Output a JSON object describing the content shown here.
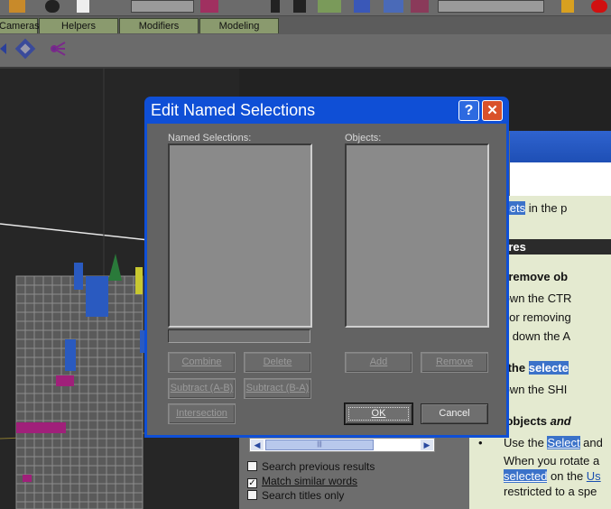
{
  "toolbar": {
    "tabs": [
      "Cameras",
      "Helpers",
      "Modifiers",
      "Modeling"
    ]
  },
  "dialog": {
    "title": "Edit Named Selections",
    "help_label": "?",
    "close_label": "✕",
    "named_selections_label": "Named Selections:",
    "objects_label": "Objects:",
    "buttons": {
      "combine": "Combine",
      "delete": "Delete",
      "subtract_ab": "Subtract (A-B)",
      "subtract_ba": "Subtract (B-A)",
      "intersection": "Intersection",
      "add": "Add",
      "remove": "Remove",
      "ok": "OK",
      "cancel": "Cancel"
    }
  },
  "help": {
    "line1_hl": "ection sets",
    "line1_rest": " in the p",
    "procedures": "rocedures",
    "add_remove": "add or remove ob",
    "hold_ctr": "Hold down the CTR",
    "adding": "Adding or removing",
    "holding_a": "Holding down the A",
    "toggle_pre": "toggle the ",
    "toggle_hl": "selecte",
    "hold_shi": "Hold down the SHI",
    "select_hl": "select",
    "select_rest": " objects ",
    "select_it": "and",
    "bullet": "•",
    "use_the": "Use the ",
    "use_link": "Select",
    "use_rest": " and",
    "when_rotate": "When you rotate a",
    "selected_link": "selected",
    "on_the": " on the ",
    "us_link": "Us",
    "restricted": "restricted to a spe",
    "scroll_grip": "|||",
    "options": {
      "search_previous": "Search previous results",
      "match_similar": "Match similar words",
      "search_titles": "Search titles only"
    },
    "check_mark": "✓"
  }
}
